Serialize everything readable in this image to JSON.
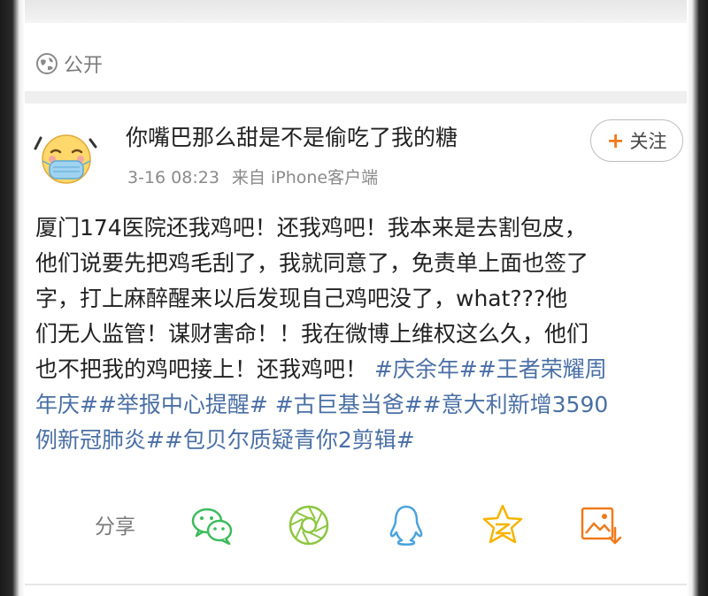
{
  "visibility": {
    "label": "公开",
    "icon": "globe-icon"
  },
  "post": {
    "username": "你嘴巴那么甜是不是偷吃了我的糖",
    "date": "3-16 08:23",
    "source": "来自 iPhone客户端",
    "follow": {
      "plus": "+",
      "label": "关注"
    },
    "content": {
      "line1": "厦门174医院还我鸡吧！还我鸡吧！我本来是去割包皮，",
      "line2": "他们说要先把鸡毛刮了，我就同意了，免责单上面也签了",
      "line3": "字，打上麻醉醒来以后发现自己鸡吧没了，what???他",
      "line4": "们无人监管！谋财害命！！我在微博上维权这么久，他们",
      "line5_text": "也不把我的鸡吧接上！还我鸡吧！",
      "line5_tag": "#庆余年##王者荣耀周",
      "line6_tag": "年庆##举报中心提醒# #古巨基当爸##意大利新增3590",
      "line7_tag": "例新冠肺炎##包贝尔质疑青你2剪辑#"
    }
  },
  "share": {
    "label": "分享",
    "icons": [
      "wechat-icon",
      "moments-icon",
      "qq-icon",
      "qzone-icon",
      "save-image-icon"
    ]
  },
  "colors": {
    "tag": "#4a6fa5",
    "wechat": "#3dbb5d",
    "moments": "#8cc63f",
    "qq": "#4aa3df",
    "qzone": "#f5b400",
    "save": "#f07a1b"
  }
}
